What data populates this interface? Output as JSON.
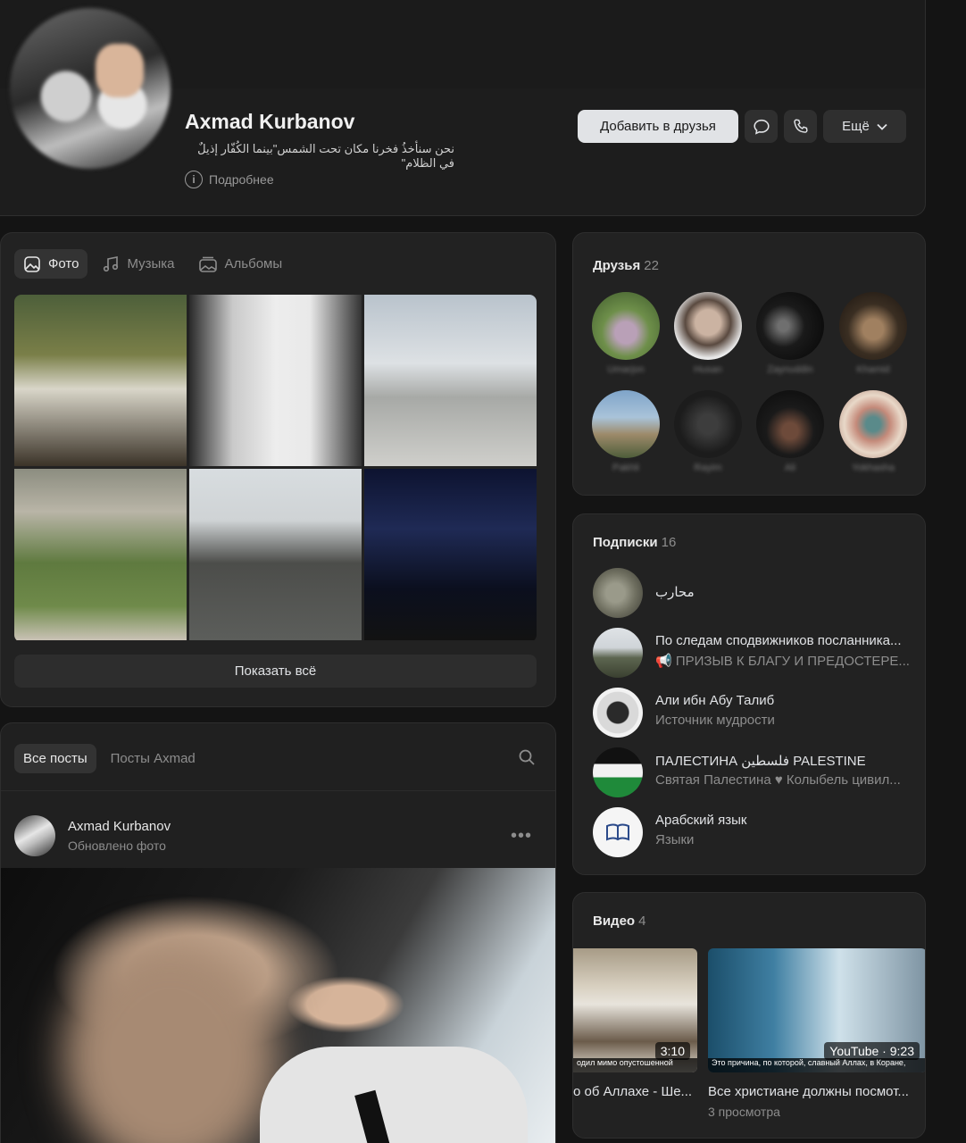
{
  "profile": {
    "name": "Axmad Kurbanov",
    "status": "نحن سنأخذُ فخرنا مكان تحت الشمس\"بينما الكُفّار إذيلٌ في الظلام\"",
    "details_label": "Подробнее",
    "add_friend_label": "Добавить в друзья",
    "more_label": "Ещё"
  },
  "media_tabs": [
    "Фото",
    "Музыка",
    "Альбомы"
  ],
  "show_all_label": "Показать всё",
  "posts": {
    "tabs": [
      "Все посты",
      "Посты Axmad"
    ],
    "item": {
      "author": "Axmad Kurbanov",
      "action": "Обновлено фото"
    }
  },
  "friends": {
    "title": "Друзья",
    "count": "22",
    "names": [
      "Umarjon",
      "Husan",
      "Zaynuddin",
      "Khamid",
      "Pakhli",
      "Rayim",
      "Ali",
      "Yokhasha"
    ]
  },
  "subscriptions": {
    "title": "Подписки",
    "count": "16",
    "items": [
      {
        "title": "محارب",
        "subtitle": ""
      },
      {
        "title": "По следам сподвижников посланника...",
        "subtitle": "📢 ПРИЗЫВ К БЛАГУ И ПРЕДОСТЕРЕ..."
      },
      {
        "title": "Али ибн Абу Талиб",
        "subtitle": "Источник мудрости"
      },
      {
        "title": "ПАЛЕСТИНА فلسطين PALESTINE",
        "subtitle": "Святая Палестина ♥ Колыбель цивил..."
      },
      {
        "title": "Арабский язык",
        "subtitle": "Языки"
      }
    ]
  },
  "videos": {
    "title": "Видео",
    "count": "4",
    "items": [
      {
        "title": "о об Аллахе - Ше...",
        "duration": "3:10",
        "caption": "одил мимо опустошенной",
        "views": ""
      },
      {
        "title": "Все христиане должны посмот...",
        "duration": "YouTube · 9:23",
        "caption": "Это причина, по которой, славный Аллах, в Коране,",
        "views": "3 просмотра"
      }
    ]
  },
  "colors": {
    "background": "#141414",
    "card": "#222222",
    "accent_button": "#e1e3e6"
  }
}
